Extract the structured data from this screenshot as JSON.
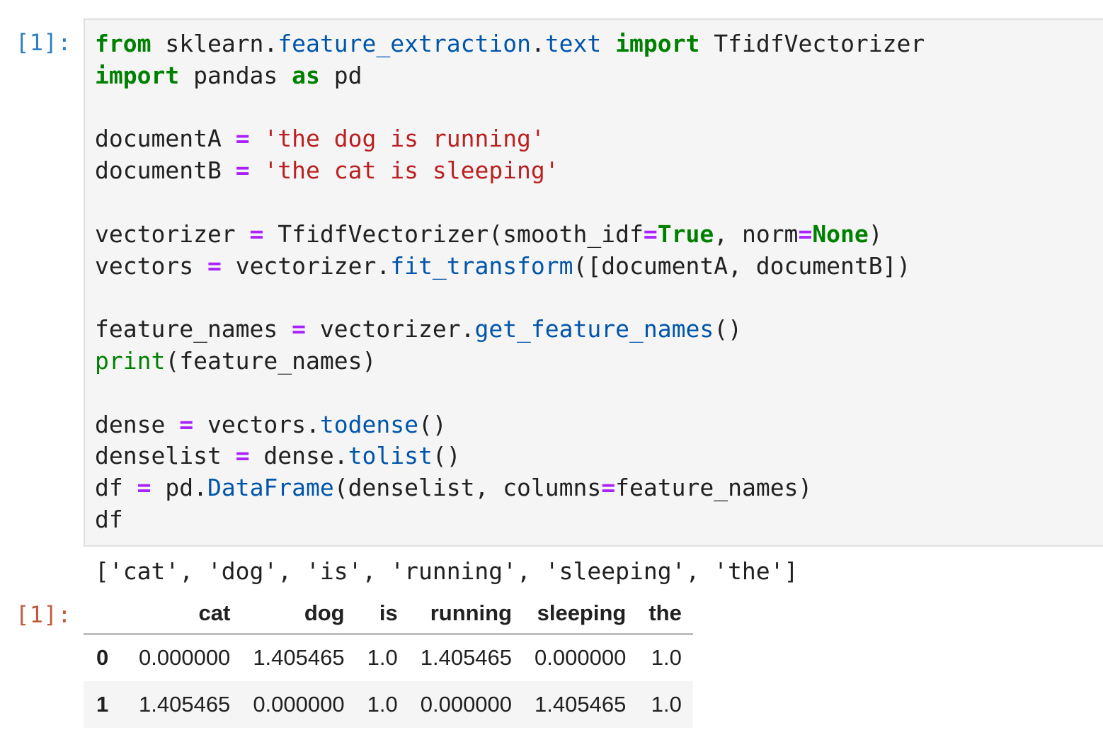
{
  "cell": {
    "input_prompt": "[1]:",
    "output_prompt": "[1]:",
    "code_lines": [
      [
        {
          "t": "from",
          "c": "kw"
        },
        {
          "t": " sklearn"
        },
        {
          "t": ".",
          "c": ""
        },
        {
          "t": "feature_extraction",
          "c": "at"
        },
        {
          "t": "."
        },
        {
          "t": "text",
          "c": "at"
        },
        {
          "t": " "
        },
        {
          "t": "import",
          "c": "kw"
        },
        {
          "t": " TfidfVectorizer"
        }
      ],
      [
        {
          "t": "import",
          "c": "kw"
        },
        {
          "t": " pandas "
        },
        {
          "t": "as",
          "c": "kw"
        },
        {
          "t": " pd"
        }
      ],
      [],
      [
        {
          "t": "documentA "
        },
        {
          "t": "=",
          "c": "op"
        },
        {
          "t": " "
        },
        {
          "t": "'the dog is running'",
          "c": "st"
        }
      ],
      [
        {
          "t": "documentB "
        },
        {
          "t": "=",
          "c": "op"
        },
        {
          "t": " "
        },
        {
          "t": "'the cat is sleeping'",
          "c": "st"
        }
      ],
      [],
      [
        {
          "t": "vectorizer "
        },
        {
          "t": "=",
          "c": "op"
        },
        {
          "t": " TfidfVectorizer(smooth_idf"
        },
        {
          "t": "=",
          "c": "op"
        },
        {
          "t": "True",
          "c": "kw"
        },
        {
          "t": ", norm"
        },
        {
          "t": "=",
          "c": "op"
        },
        {
          "t": "None",
          "c": "kw"
        },
        {
          "t": ")"
        }
      ],
      [
        {
          "t": "vectors "
        },
        {
          "t": "=",
          "c": "op"
        },
        {
          "t": " vectorizer."
        },
        {
          "t": "fit_transform",
          "c": "fn"
        },
        {
          "t": "([documentA, documentB])"
        }
      ],
      [],
      [
        {
          "t": "feature_names "
        },
        {
          "t": "=",
          "c": "op"
        },
        {
          "t": " vectorizer."
        },
        {
          "t": "get_feature_names",
          "c": "fn"
        },
        {
          "t": "()"
        }
      ],
      [
        {
          "t": "print",
          "c": "bi"
        },
        {
          "t": "(feature_names)"
        }
      ],
      [],
      [
        {
          "t": "dense "
        },
        {
          "t": "=",
          "c": "op"
        },
        {
          "t": " vectors."
        },
        {
          "t": "todense",
          "c": "fn"
        },
        {
          "t": "()"
        }
      ],
      [
        {
          "t": "denselist "
        },
        {
          "t": "=",
          "c": "op"
        },
        {
          "t": " dense."
        },
        {
          "t": "tolist",
          "c": "fn"
        },
        {
          "t": "()"
        }
      ],
      [
        {
          "t": "df "
        },
        {
          "t": "=",
          "c": "op"
        },
        {
          "t": " pd."
        },
        {
          "t": "DataFrame",
          "c": "fn"
        },
        {
          "t": "(denselist, columns"
        },
        {
          "t": "=",
          "c": "op"
        },
        {
          "t": "feature_names)"
        }
      ],
      [
        {
          "t": "df"
        }
      ]
    ],
    "stdout": "['cat', 'dog', 'is', 'running', 'sleeping', 'the']",
    "dataframe": {
      "columns": [
        "cat",
        "dog",
        "is",
        "running",
        "sleeping",
        "the"
      ],
      "rows": [
        {
          "index": "0",
          "values": [
            "0.000000",
            "1.405465",
            "1.0",
            "1.405465",
            "0.000000",
            "1.0"
          ]
        },
        {
          "index": "1",
          "values": [
            "1.405465",
            "0.000000",
            "1.0",
            "0.000000",
            "1.405465",
            "1.0"
          ]
        }
      ]
    }
  }
}
